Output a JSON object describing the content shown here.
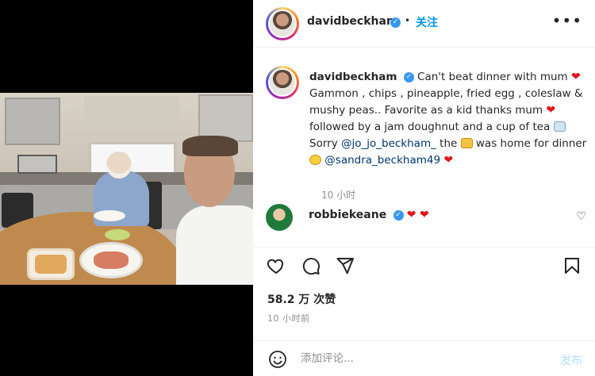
{
  "post": {
    "username": "davidbeckham",
    "follow_label": "关注",
    "more_label": "•••",
    "caption": {
      "username": "davidbeckham",
      "part1": "Can't beat dinner with mum",
      "part2": "Gammon , chips , pineapple, fried egg , coleslaw & mushy peas.. Favorite as a kid thanks mum",
      "part3": "followed by a jam doughnut and a cup of tea",
      "part4": "Sorry",
      "mention1": "@jo_jo_beckham_",
      "part5": "the",
      "part6": "was home for dinner",
      "mention2": "@sandra_beckham49",
      "time": "10 小时"
    },
    "comment2": {
      "username": "robbiekeane",
      "hearts": "❤ ❤"
    },
    "likes": "58.2 万 次赞",
    "time": "10 小时前",
    "add_comment_placeholder": "添加评论...",
    "post_label": "发布"
  },
  "icons": {
    "heart": "heart-icon",
    "comment": "comment-icon",
    "share": "share-icon",
    "save": "bookmark-icon",
    "emoji": "emoji-icon"
  },
  "colors": {
    "accent": "#0095f6",
    "verified": "#3897f0",
    "heart": "#e0161f",
    "muted": "#8e8e8e"
  }
}
